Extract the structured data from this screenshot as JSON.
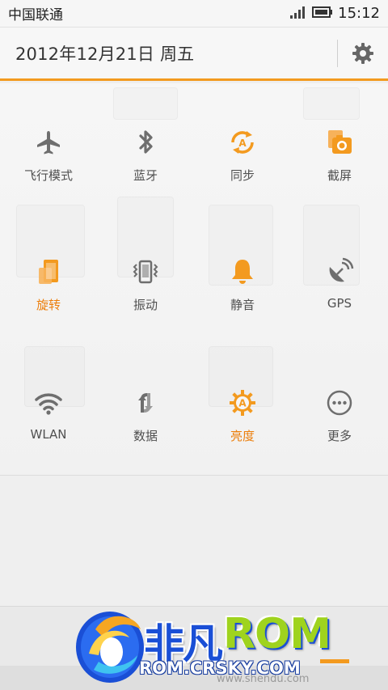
{
  "status_bar": {
    "carrier": "中国联通",
    "time": "15:12",
    "signal_icon": "signal-bars-icon",
    "battery_icon": "battery-icon"
  },
  "header": {
    "date": "2012年12月21日 周五",
    "settings_icon": "gear-icon"
  },
  "toggles": [
    {
      "id": "airplane",
      "label": "飞行模式",
      "icon": "airplane-icon",
      "active": false
    },
    {
      "id": "bluetooth",
      "label": "蓝牙",
      "icon": "bluetooth-icon",
      "active": false
    },
    {
      "id": "sync",
      "label": "同步",
      "icon": "sync-icon",
      "active": false
    },
    {
      "id": "screenshot",
      "label": "截屏",
      "icon": "screenshot-icon",
      "active": false
    },
    {
      "id": "rotate",
      "label": "旋转",
      "icon": "rotate-icon",
      "active": true
    },
    {
      "id": "vibrate",
      "label": "振动",
      "icon": "vibrate-icon",
      "active": false
    },
    {
      "id": "mute",
      "label": "静音",
      "icon": "bell-icon",
      "active": false
    },
    {
      "id": "gps",
      "label": "GPS",
      "icon": "gps-icon",
      "active": false
    },
    {
      "id": "wlan",
      "label": "WLAN",
      "icon": "wifi-icon",
      "active": false
    },
    {
      "id": "data",
      "label": "数据",
      "icon": "data-icon",
      "active": false
    },
    {
      "id": "brightness",
      "label": "亮度",
      "icon": "brightness-icon",
      "active": true
    },
    {
      "id": "more",
      "label": "更多",
      "icon": "more-icon",
      "active": false
    }
  ],
  "colors": {
    "accent": "#f39a1f",
    "active_label": "#ec7f0c",
    "icon_gray": "#6e6e6e"
  },
  "watermark": {
    "brand_cn": "非凡",
    "brand_rom": "ROM",
    "url": "ROM.CRSKY.COM",
    "small": "www.shendu.com"
  }
}
